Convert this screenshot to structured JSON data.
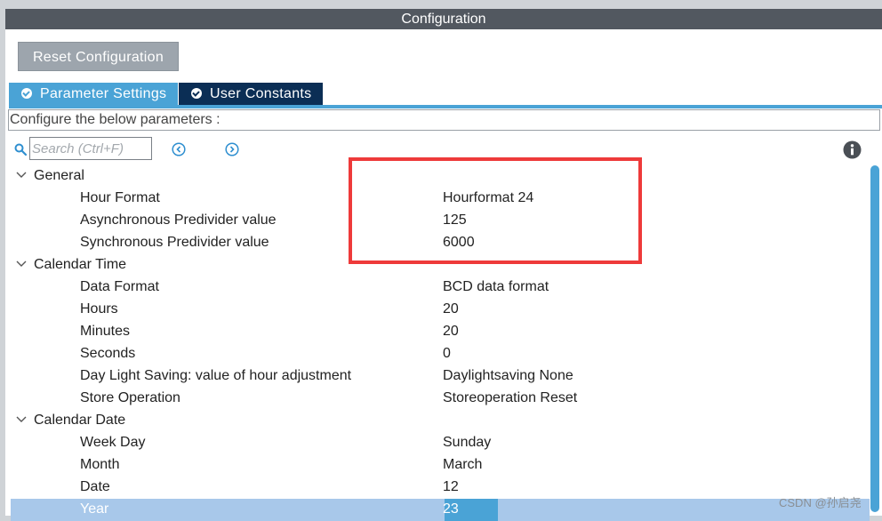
{
  "window": {
    "title": "Configuration"
  },
  "toolbar": {
    "reset_label": "Reset Configuration"
  },
  "tabs": [
    {
      "label": "Parameter Settings",
      "active": true,
      "icon": "check-circle-icon"
    },
    {
      "label": "User Constants",
      "active": false,
      "icon": "check-circle-icon"
    }
  ],
  "description": "Configure the below parameters :",
  "search": {
    "placeholder": "Search (Ctrl+F)",
    "value": ""
  },
  "icons": {
    "search": "search-icon",
    "prev": "circle-left-icon",
    "next": "circle-right-icon",
    "info": "info-icon",
    "expand": "chevron-down-icon"
  },
  "groups": [
    {
      "label": "General",
      "params": [
        {
          "name": "Hour Format",
          "value": "Hourformat 24"
        },
        {
          "name": "Asynchronous Predivider value",
          "value": "125"
        },
        {
          "name": "Synchronous Predivider value",
          "value": "6000"
        }
      ]
    },
    {
      "label": "Calendar Time",
      "params": [
        {
          "name": "Data Format",
          "value": "BCD data format"
        },
        {
          "name": "Hours",
          "value": "20"
        },
        {
          "name": "Minutes",
          "value": "20"
        },
        {
          "name": "Seconds",
          "value": "0"
        },
        {
          "name": "Day Light Saving: value of hour adjustment",
          "value": "Daylightsaving None"
        },
        {
          "name": "Store Operation",
          "value": "Storeoperation Reset"
        }
      ]
    },
    {
      "label": "Calendar Date",
      "params": [
        {
          "name": "Week Day",
          "value": "Sunday"
        },
        {
          "name": "Month",
          "value": "March"
        },
        {
          "name": "Date",
          "value": "12"
        },
        {
          "name": "Year",
          "value": "23",
          "selected": true
        }
      ]
    }
  ],
  "watermark": "CSDN @孙启尧",
  "colors": {
    "accent": "#4aa3d6",
    "titlebar": "#525860",
    "tab_inactive": "#0b2e55",
    "annotation": "#ee3a3a",
    "selection": "#a8c8ea"
  }
}
